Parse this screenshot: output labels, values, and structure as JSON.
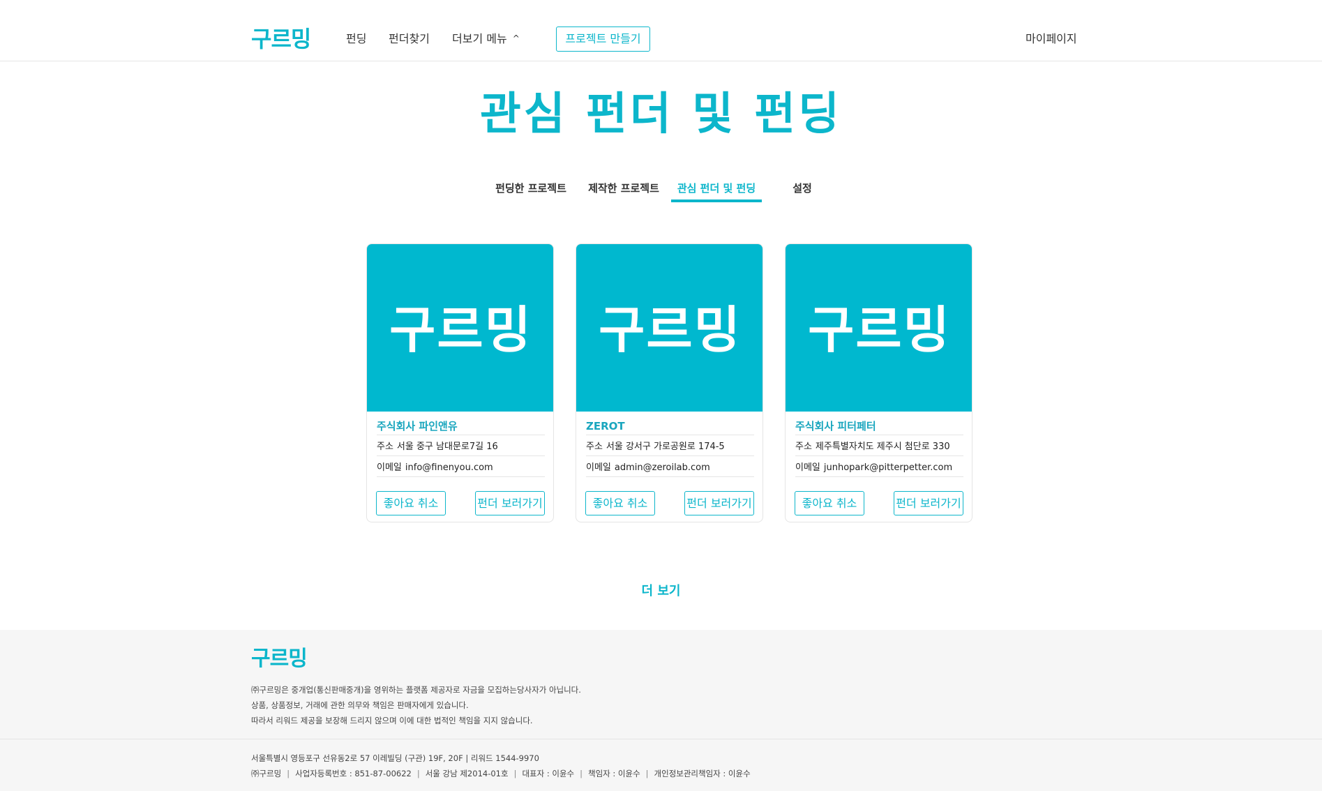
{
  "header": {
    "logo": "구르밍",
    "nav": {
      "funding": "펀딩",
      "find_funders": "펀더찾기",
      "more_menu": "더보기 메뉴",
      "more_chevron": "^"
    },
    "create_project": "프로젝트 만들기",
    "mypage": "마이페이지"
  },
  "page": {
    "title": "관심 펀더 및 펀딩"
  },
  "tabs": [
    {
      "label": "펀딩한 프로젝트",
      "active": false
    },
    {
      "label": "제작한 프로젝트",
      "active": false
    },
    {
      "label": "관심 펀더 및 펀딩",
      "active": true
    },
    {
      "label": "설정",
      "active": false
    }
  ],
  "cards": [
    {
      "thumb_logo": "구르밍",
      "name": "주식회사 파인앤유",
      "address_label": "주소",
      "address": "서울 중구 남대문로7길 16",
      "email_label": "이메일",
      "email": "info@finenyou.com",
      "unlike_label": "좋아요 취소",
      "view_label": "펀더 보러가기"
    },
    {
      "thumb_logo": "구르밍",
      "name": "ZEROT",
      "address_label": "주소",
      "address": "서울 강서구 가로공원로 174-5",
      "email_label": "이메일",
      "email": "admin@zeroilab.com",
      "unlike_label": "좋아요 취소",
      "view_label": "펀더 보러가기"
    },
    {
      "thumb_logo": "구르밍",
      "name": "주식회사 피터페터",
      "address_label": "주소",
      "address": "제주특별자치도 제주시 첨단로 330",
      "email_label": "이메일",
      "email": "junhopark@pitterpetter.com",
      "unlike_label": "좋아요 취소",
      "view_label": "펀더 보러가기"
    }
  ],
  "more_label": "더 보기",
  "footer": {
    "logo": "구르밍",
    "notice": [
      "㈜구르밍은 중개업(통신판매중개)을 영위하는 플랫폼 제공자로 자금을 모집하는당사자가 아닙니다.",
      "상품, 상품정보, 거래에 관한 의무와 책임은 판매자에게 있습니다.",
      "따라서 리워드 제공을 보장해 드리지 않으며 이에 대한 법적인 책임을 지지 않습니다."
    ],
    "address": "서울특별시 영등포구 선유동2로 57 이레빌딩 (구관) 19F, 20F | 리워드 1544-9970",
    "info": [
      "㈜구르밍",
      "사업자등록번호 : 851-87-00622",
      "서울 강남 제2014-01호",
      "대표자 : 이윤수",
      "책임자 : 이윤수",
      "개인정보관리책임자 : 이윤수"
    ],
    "separator": "|"
  },
  "colors": {
    "accent": "#0cb6cb",
    "thumb_bg": "#00b8cf",
    "footer_bg": "#f6f6f6"
  }
}
